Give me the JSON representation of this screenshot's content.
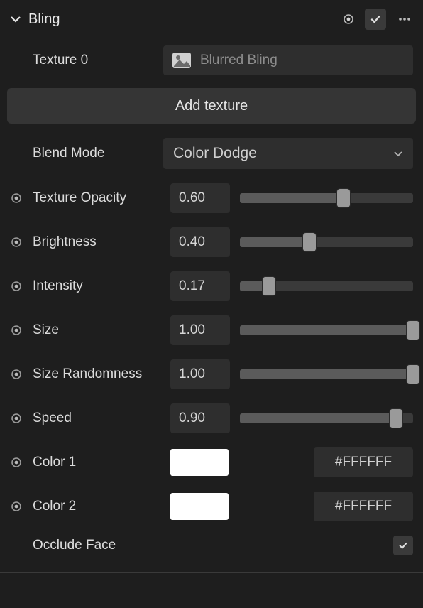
{
  "header": {
    "title": "Bling"
  },
  "texture": {
    "label": "Texture 0",
    "name": "Blurred Bling"
  },
  "addTextureLabel": "Add texture",
  "blendMode": {
    "label": "Blend Mode",
    "value": "Color Dodge"
  },
  "params": {
    "textureOpacity": {
      "label": "Texture Opacity",
      "value": "0.60",
      "pct": 60
    },
    "brightness": {
      "label": "Brightness",
      "value": "0.40",
      "pct": 40
    },
    "intensity": {
      "label": "Intensity",
      "value": "0.17",
      "pct": 17
    },
    "size": {
      "label": "Size",
      "value": "1.00",
      "pct": 100
    },
    "sizeRandomness": {
      "label": "Size Randomness",
      "value": "1.00",
      "pct": 100
    },
    "speed": {
      "label": "Speed",
      "value": "0.90",
      "pct": 90
    }
  },
  "colors": {
    "color1": {
      "label": "Color 1",
      "hex": "#FFFFFF",
      "swatch": "#FFFFFF"
    },
    "color2": {
      "label": "Color 2",
      "hex": "#FFFFFF",
      "swatch": "#FFFFFF"
    }
  },
  "occludeFace": {
    "label": "Occlude Face",
    "checked": true
  }
}
